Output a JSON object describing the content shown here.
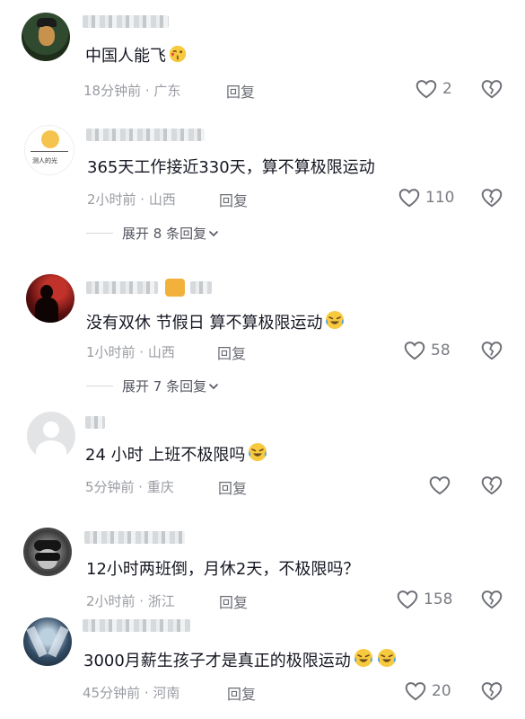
{
  "comments": [
    {
      "text": "中国人能飞",
      "meta": "18分钟前 · 广东",
      "reply": "回复",
      "likes": "2",
      "emoji": "kissing-wink-emoji"
    },
    {
      "text": "365天工作接近330天，算不算极限运动",
      "meta": "2小时前 · 山西",
      "reply": "回复",
      "likes": "110",
      "expand": "展开 8 条回复"
    },
    {
      "text": "没有双休 节假日 算不算极限运动",
      "meta": "1小时前 · 山西",
      "reply": "回复",
      "likes": "58",
      "emoji": "crying-laughing-emoji",
      "expand": "展开 7 条回复"
    },
    {
      "text": "24 小时 上班不极限吗",
      "meta": "5分钟前 · 重庆",
      "reply": "回复",
      "likes": "",
      "emoji": "crying-laughing-emoji"
    },
    {
      "text": "12小时两班倒，月休2天，不极限吗？",
      "meta": "2小时前 · 浙江",
      "reply": "回复",
      "likes": "158"
    },
    {
      "text": "3000月薪生孩子才是真正的极限运动",
      "meta": "45分钟前 · 河南",
      "reply": "回复",
      "likes": "20",
      "emoji": "crying-laughing-emoji"
    }
  ],
  "icons": {
    "like": "heart-outline-icon",
    "dislike": "broken-heart-icon",
    "expand": "chevron-down-icon"
  },
  "colors": {
    "text": "#161823",
    "meta": "#9a9ca3",
    "emoji": "#f7c93e",
    "tear": "#4aa3ee"
  }
}
